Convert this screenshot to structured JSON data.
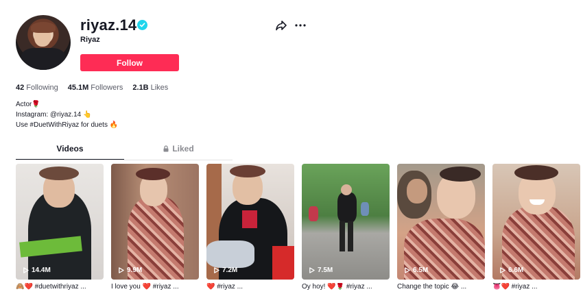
{
  "profile": {
    "username": "riyaz.14",
    "display_name": "Riyaz",
    "follow_label": "Follow"
  },
  "stats": {
    "following_count": "42",
    "following_label": "Following",
    "followers_count": "45.1M",
    "followers_label": "Followers",
    "likes_count": "2.1B",
    "likes_label": "Likes"
  },
  "bio": {
    "line1": "Actor🌹",
    "line2": "Instagram: @riyaz.14 👆",
    "line3": "Use #DuetWithRiyaz for duets 🔥"
  },
  "tabs": {
    "videos": "Videos",
    "liked": "Liked"
  },
  "videos": [
    {
      "views": "14.4M",
      "caption": "🙈❤️ #duetwithriyaz ..."
    },
    {
      "views": "9.9M",
      "caption": "I love you ❤️ #riyaz ..."
    },
    {
      "views": "7.2M",
      "caption": "❤️ #riyaz ..."
    },
    {
      "views": "7.5M",
      "caption": "Oy hoy! ❤️🌹 #riyaz ..."
    },
    {
      "views": "6.5M",
      "caption": "Change the topic 😂 ..."
    },
    {
      "views": "6.6M",
      "caption": "👅❤️ #riyaz ..."
    }
  ],
  "colors": {
    "follow_button": "#fe2c55",
    "verified_badge": "#20d5ec",
    "text_primary": "#161823",
    "text_secondary": "#595b66"
  },
  "icons": {
    "share": "share-arrow-icon",
    "more": "more-dots-icon",
    "verified": "verified-check-icon",
    "lock": "lock-icon",
    "play": "play-icon"
  }
}
